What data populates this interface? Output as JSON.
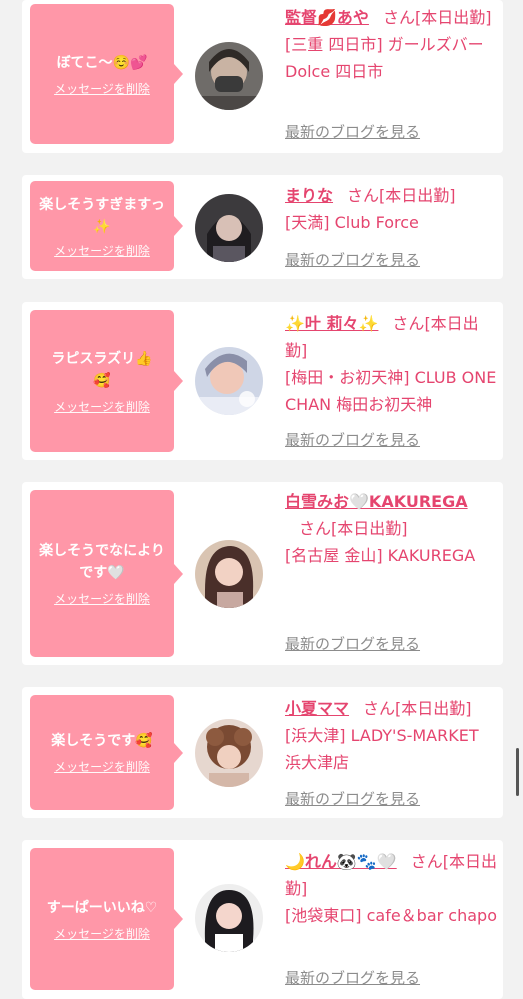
{
  "theme": {
    "bubble_color": "#ff97a8",
    "accent": "#e5456f",
    "link_gray": "#8c8c8c"
  },
  "delete_label": "メッセージを削除",
  "blog_label": "最新のブログを見る",
  "cards": [
    {
      "message": "ぼてこ〜☺️💕",
      "name": "監督💋あや",
      "san": "さん",
      "status": "[本日出勤]",
      "area": "[三重 四日市]",
      "shop": "ガールズバー Dolce 四日市"
    },
    {
      "message": "楽しそうすぎますっ✨",
      "name": "まりな",
      "san": "さん",
      "status": "[本日出勤]",
      "area": "[天満]",
      "shop": "Club Force"
    },
    {
      "message": "ラピスラズリ👍🥰",
      "name": "✨叶 莉々✨",
      "san": "さん",
      "status": "[本日出勤]",
      "area": "[梅田・お初天神]",
      "shop": "CLUB ONE CHAN 梅田お初天神"
    },
    {
      "message": "楽しそうでなによりです🤍",
      "name": "白雪みお🤍KAKUREGA",
      "san": "さん",
      "status": "[本日出勤]",
      "area": "[名古屋 金山]",
      "shop": "KAKUREGA"
    },
    {
      "message": "楽しそうです🥰",
      "name": "小夏ママ",
      "san": "さん",
      "status": "[本日出勤]",
      "area": "[浜大津]",
      "shop": "LADY'S-MARKET 浜大津店"
    },
    {
      "message": "すーぱーいいね♡",
      "name": "🌙れん🐼🐾🤍",
      "san": "さん",
      "status": "[本日出勤]",
      "area": "[池袋東口]",
      "shop": "cafe＆bar chapo"
    }
  ]
}
